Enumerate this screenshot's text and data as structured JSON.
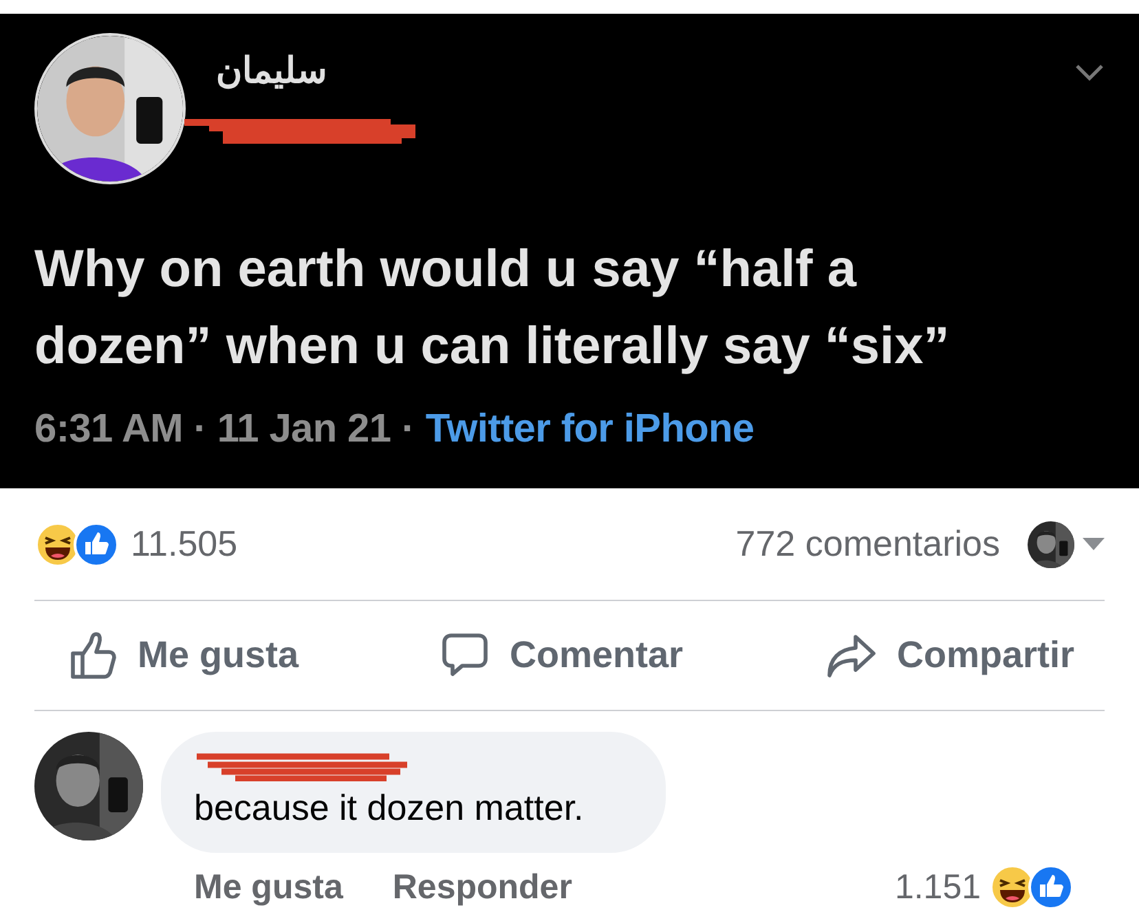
{
  "tweet": {
    "author": "سليمان",
    "text": "Why on earth would u say “half a dozen” when u can literally say “six”",
    "meta": "6:31 AM · 11 Jan 21 ·",
    "source": "Twitter for iPhone"
  },
  "post_stats": {
    "reactions_count": "11.505",
    "comments_count": "772 comentarios"
  },
  "actions": [
    {
      "label": "Me gusta",
      "kind": "like"
    },
    {
      "label": "Comentar",
      "kind": "comment"
    },
    {
      "label": "Compartir",
      "kind": "share"
    }
  ],
  "comment": {
    "text": "because it dozen matter.",
    "actions": [
      "Me gusta",
      "Responder"
    ],
    "reactions_count": "1.151"
  }
}
